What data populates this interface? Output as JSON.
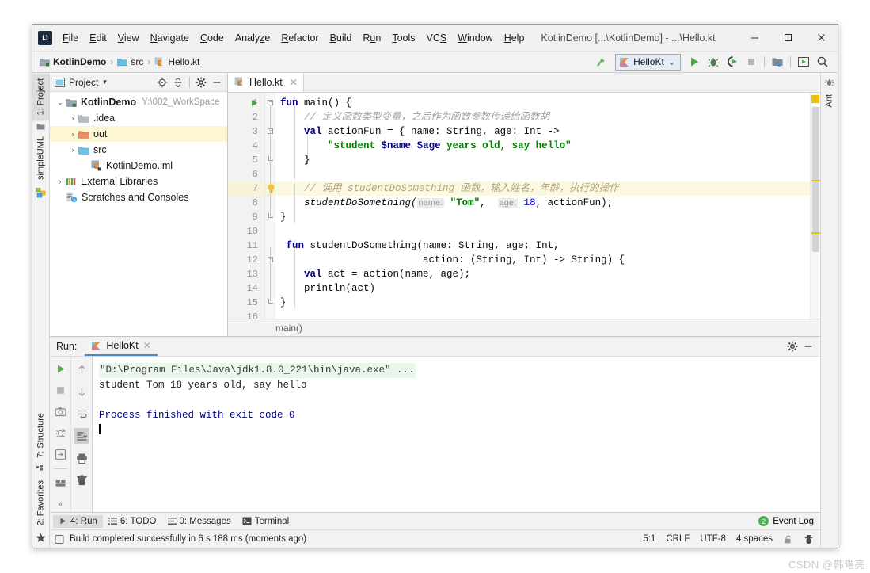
{
  "window": {
    "title": "KotlinDemo [...\\KotlinDemo] - ...\\Hello.kt",
    "minimize": "–",
    "maximize": "☐",
    "close": "✕"
  },
  "menubar": [
    {
      "label": "File",
      "mnemonic": "F"
    },
    {
      "label": "Edit",
      "mnemonic": "E"
    },
    {
      "label": "View",
      "mnemonic": "V"
    },
    {
      "label": "Navigate",
      "mnemonic": "N"
    },
    {
      "label": "Code",
      "mnemonic": "C"
    },
    {
      "label": "Analyze",
      "mnemonic": "z"
    },
    {
      "label": "Refactor",
      "mnemonic": "R"
    },
    {
      "label": "Build",
      "mnemonic": "B"
    },
    {
      "label": "Run",
      "mnemonic": "u"
    },
    {
      "label": "Tools",
      "mnemonic": "T"
    },
    {
      "label": "VCS",
      "mnemonic": "S"
    },
    {
      "label": "Window",
      "mnemonic": "W"
    },
    {
      "label": "Help",
      "mnemonic": "H"
    }
  ],
  "navbar": {
    "crumbs": [
      "KotlinDemo",
      "src",
      "Hello.kt"
    ],
    "separator": "›",
    "run_config": "HelloKt",
    "dropdown_caret": "⌄",
    "icons": [
      "build-icon",
      "run-icon",
      "debug-icon",
      "run-coverage-icon",
      "stop-icon",
      "project-structure-icon",
      "update-icon",
      "search-everywhere-icon"
    ]
  },
  "left_rail": {
    "top": [
      {
        "label": "1: Project",
        "mnemonic": "1",
        "active": true
      },
      {
        "label": "simpleUML",
        "mnemonic": "",
        "active": false
      }
    ],
    "bottom": [
      {
        "label": "7: Structure",
        "mnemonic": "7"
      },
      {
        "label": "2: Favorites",
        "mnemonic": "2"
      }
    ]
  },
  "right_rail": {
    "tabs": [
      {
        "label": "Ant",
        "mnemonic": ""
      }
    ]
  },
  "project_pane": {
    "title": "Project",
    "caret": "▾",
    "icons": [
      "locate-icon",
      "collapse-all-icon",
      "settings-icon",
      "hide-icon"
    ],
    "tree": [
      {
        "label": "KotlinDemo",
        "sub": "Y:\\002_WorkSpace",
        "depth": 0,
        "arrow": "⌄",
        "icon": "module-folder-icon",
        "bold": true,
        "highlight": false
      },
      {
        "label": ".idea",
        "sub": "",
        "depth": 1,
        "arrow": "›",
        "icon": "folder-gray-icon",
        "bold": false,
        "highlight": false
      },
      {
        "label": "out",
        "sub": "",
        "depth": 1,
        "arrow": "›",
        "icon": "folder-orange-icon",
        "bold": false,
        "highlight": true
      },
      {
        "label": "src",
        "sub": "",
        "depth": 1,
        "arrow": "›",
        "icon": "folder-blue-icon",
        "bold": false,
        "highlight": false
      },
      {
        "label": "KotlinDemo.iml",
        "sub": "",
        "depth": 2,
        "arrow": "",
        "icon": "iml-file-icon",
        "bold": false,
        "highlight": false
      },
      {
        "label": "External Libraries",
        "sub": "",
        "depth": 0,
        "arrow": "›",
        "icon": "libraries-icon",
        "bold": false,
        "highlight": false
      },
      {
        "label": "Scratches and Consoles",
        "sub": "",
        "depth": 0,
        "arrow": "",
        "icon": "scratches-icon",
        "bold": false,
        "highlight": false
      }
    ]
  },
  "editor": {
    "tab": {
      "label": "Hello.kt",
      "close": "✕",
      "icon": "kotlin-file-icon"
    },
    "breadcrumb": "main()",
    "highlight_line": 7,
    "line_count": 16,
    "lines": [
      {
        "n": 1,
        "runnable": true,
        "fold": "collapse",
        "tokens": [
          {
            "t": "fun ",
            "c": "kw"
          },
          {
            "t": "main() {",
            "c": ""
          }
        ]
      },
      {
        "n": 2,
        "tokens": [
          {
            "t": "    // 定义函数类型变量，之后作为函数参数传递给函数胡",
            "c": "cmt"
          }
        ]
      },
      {
        "n": 3,
        "fold": "collapse",
        "tokens": [
          {
            "t": "    ",
            "c": ""
          },
          {
            "t": "val ",
            "c": "kw"
          },
          {
            "t": "actionFun = { name: String, age: Int ->",
            "c": ""
          }
        ]
      },
      {
        "n": 4,
        "tokens": [
          {
            "t": "        ",
            "c": ""
          },
          {
            "t": "\"student ",
            "c": "str"
          },
          {
            "t": "$name",
            "c": "tmpl"
          },
          {
            "t": " ",
            "c": "str"
          },
          {
            "t": "$age",
            "c": "tmpl"
          },
          {
            "t": " years old, say hello\"",
            "c": "str"
          }
        ]
      },
      {
        "n": 5,
        "fold": "end",
        "tokens": [
          {
            "t": "    }",
            "c": ""
          }
        ]
      },
      {
        "n": 6,
        "tokens": [
          {
            "t": "",
            "c": ""
          }
        ]
      },
      {
        "n": 7,
        "bulb": true,
        "tokens": [
          {
            "t": "    // 调用 studentDoSomething 函数，输入姓名，年龄，执行的操作",
            "c": "cmt-hl"
          }
        ]
      },
      {
        "n": 8,
        "tokens": [
          {
            "t": "    ",
            "c": ""
          },
          {
            "t": "studentDoSomething(",
            "c": "fn-it"
          },
          {
            "t": "name:",
            "c": "hint"
          },
          {
            "t": " ",
            "c": ""
          },
          {
            "t": "\"Tom\"",
            "c": "str"
          },
          {
            "t": ",  ",
            "c": ""
          },
          {
            "t": "age:",
            "c": "hint"
          },
          {
            "t": " ",
            "c": ""
          },
          {
            "t": "18",
            "c": "num"
          },
          {
            "t": ", actionFun);",
            "c": ""
          }
        ]
      },
      {
        "n": 9,
        "fold": "end",
        "tokens": [
          {
            "t": "}",
            "c": ""
          }
        ]
      },
      {
        "n": 10,
        "tokens": [
          {
            "t": "",
            "c": ""
          }
        ]
      },
      {
        "n": 11,
        "tokens": [
          {
            "t": " ",
            "c": ""
          },
          {
            "t": "fun ",
            "c": "kw"
          },
          {
            "t": "studentDoSomething(name: String, age: Int,",
            "c": ""
          }
        ]
      },
      {
        "n": 12,
        "fold": "collapse",
        "tokens": [
          {
            "t": "                        action: (String, Int) -> String) {",
            "c": ""
          }
        ]
      },
      {
        "n": 13,
        "tokens": [
          {
            "t": "    ",
            "c": ""
          },
          {
            "t": "val ",
            "c": "kw"
          },
          {
            "t": "act = action(name, age);",
            "c": ""
          }
        ]
      },
      {
        "n": 14,
        "tokens": [
          {
            "t": "    println(act)",
            "c": ""
          }
        ]
      },
      {
        "n": 15,
        "fold": "end",
        "tokens": [
          {
            "t": "}",
            "c": ""
          }
        ]
      },
      {
        "n": 16,
        "tokens": [
          {
            "t": "",
            "c": ""
          }
        ]
      }
    ]
  },
  "run_window": {
    "label": "Run:",
    "tab": {
      "label": "HelloKt",
      "close": "✕",
      "icon": "kotlin-run-icon"
    },
    "header_icons": [
      "settings-icon",
      "hide-icon"
    ],
    "left_tools": [
      "rerun-icon",
      "stop-icon",
      "dump-threads-icon",
      "restore-layout-icon",
      "export-icon",
      "layout-icon",
      "more-icon"
    ],
    "right_tools": [
      "up-stack-icon",
      "down-stack-icon",
      "soft-wrap-icon",
      "scroll-to-end-icon",
      "print-icon",
      "clear-all-icon"
    ],
    "console": [
      {
        "text": "\"D:\\Program Files\\Java\\jdk1.8.0_221\\bin\\java.exe\" ...",
        "style": "cmd"
      },
      {
        "text": "student Tom 18 years old, say hello",
        "style": "out"
      },
      {
        "text": "",
        "style": "out"
      },
      {
        "text": "Process finished with exit code 0",
        "style": "sys"
      }
    ]
  },
  "bottom_toolbar": {
    "buttons": [
      {
        "label": "4: Run",
        "mnemonic": "4",
        "icon": "run-icon",
        "active": true
      },
      {
        "label": "6: TODO",
        "mnemonic": "6",
        "icon": "todo-icon",
        "active": false
      },
      {
        "label": "0: Messages",
        "mnemonic": "0",
        "icon": "messages-icon",
        "active": false
      },
      {
        "label": "Terminal",
        "mnemonic": "",
        "icon": "terminal-icon",
        "active": false
      }
    ],
    "event_log": {
      "label": "Event Log",
      "count": "2"
    }
  },
  "statusbar": {
    "message": "Build completed successfully in 6 s 188 ms (moments ago)",
    "caret_position": "5:1",
    "line_separator": "CRLF",
    "encoding": "UTF-8",
    "indent": "4 spaces",
    "icons": [
      "lock-icon",
      "inspection-icon"
    ]
  },
  "watermark": "CSDN @韩曙亮",
  "colors": {
    "accent": "#4a88c7",
    "keyword": "#000080",
    "string": "#008000",
    "comment": "#a0a0a0",
    "highlight_row": "#fcf9e3",
    "tree_highlight": "#fdf6d5",
    "run_green": "#4a9b4a"
  }
}
